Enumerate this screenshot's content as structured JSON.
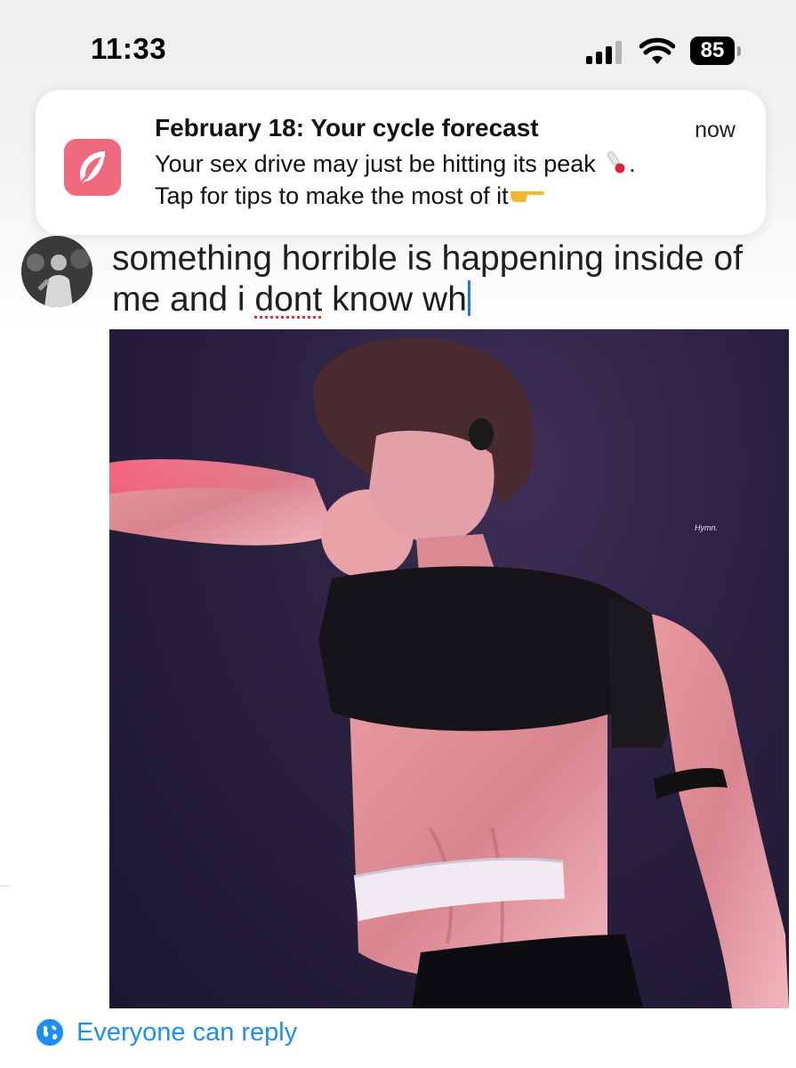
{
  "status_bar": {
    "time": "11:33",
    "battery": "85"
  },
  "notification": {
    "title": "February 18: Your cycle forecast",
    "time": "now",
    "line1": "Your sex drive may just be hitting its peak",
    "line2": "Tap for tips to make the most of it",
    "app_icon": "feather-icon",
    "app_color": "#f06a7d"
  },
  "composer": {
    "text_before": "something horrible is happening inside of me and i ",
    "misspelled_word": "dont",
    "text_after": " know wh",
    "photo_credit": "Hymn."
  },
  "reply_setting": {
    "label": "Everyone can reply",
    "icon": "globe-icon",
    "color": "#1d8ff0"
  }
}
